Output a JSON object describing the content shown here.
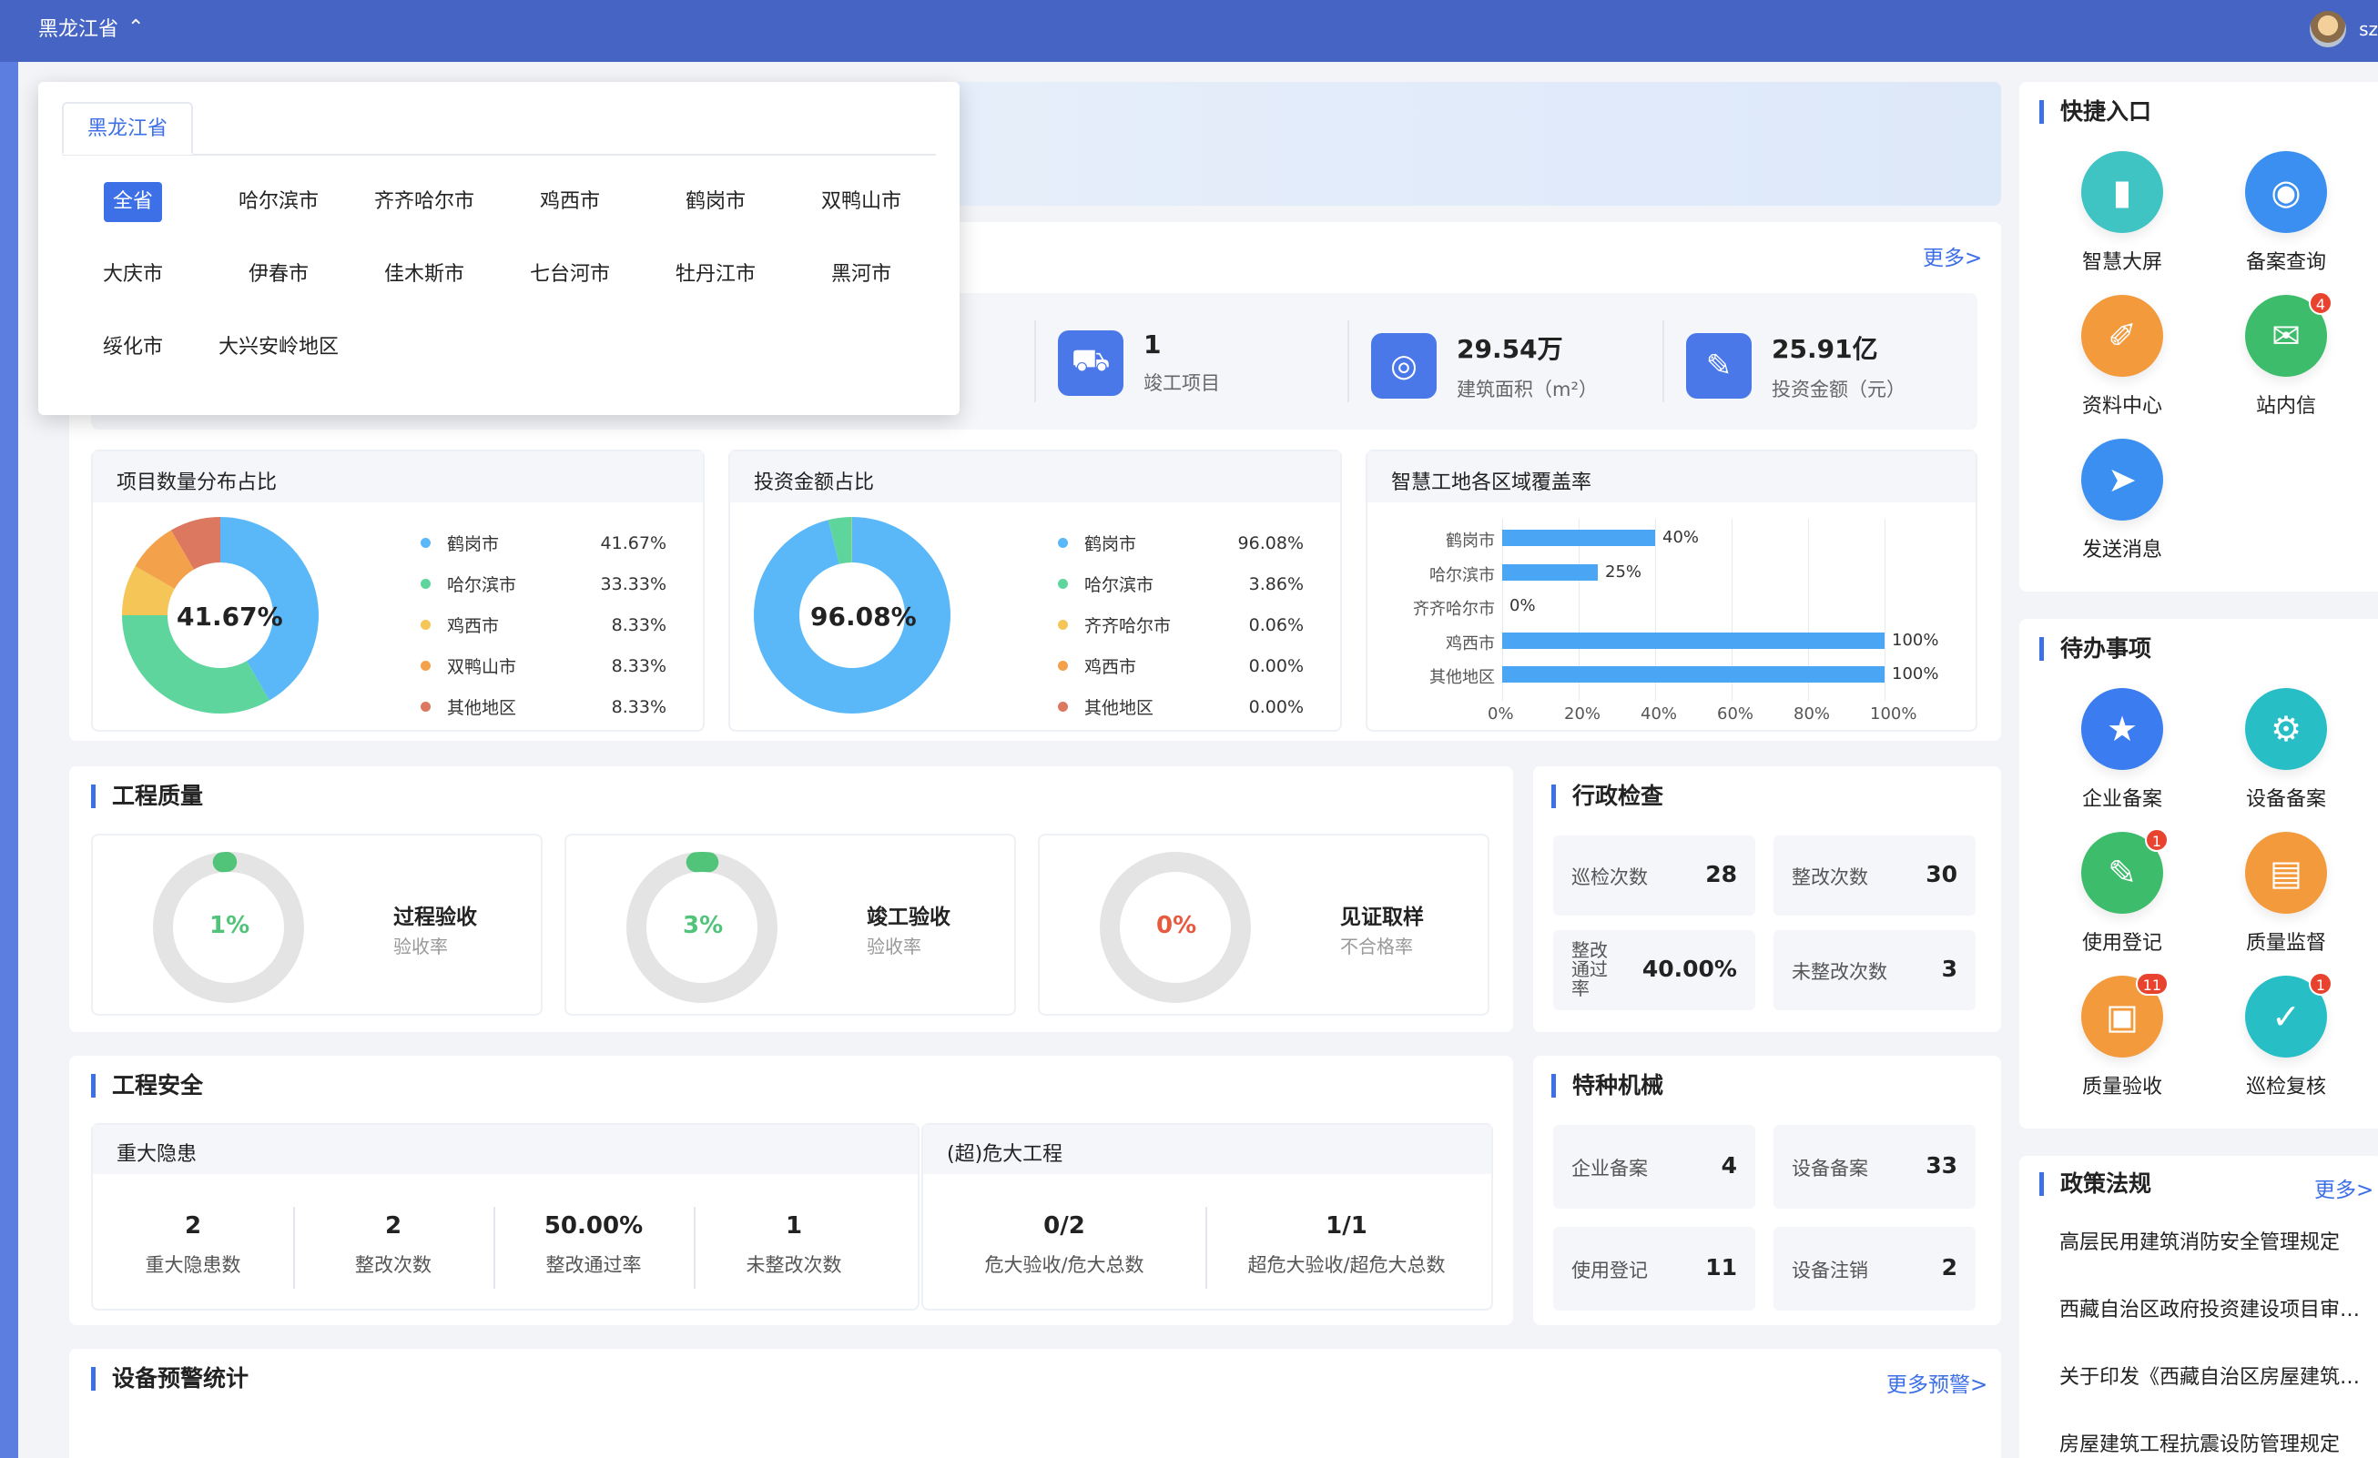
{
  "topbar": {
    "province": "黑龙江省",
    "username": "sz"
  },
  "overview": {
    "more": "更多>",
    "stats": [
      {
        "value": "1",
        "label": "竣工项目"
      },
      {
        "value": "29.54万",
        "label": "建筑面积（m²）"
      },
      {
        "value": "25.91亿",
        "label": "投资金额（元）"
      }
    ]
  },
  "panels": {
    "project_title": "项目数量分布占比",
    "invest_title": "投资金额占比",
    "coverage_title": "智慧工地各区域覆盖率"
  },
  "chart_data": [
    {
      "type": "pie",
      "title": "项目数量分布占比",
      "center_label": "41.67%",
      "categories": [
        "鹤岗市",
        "哈尔滨市",
        "鸡西市",
        "双鸭山市",
        "其他地区"
      ],
      "values": [
        41.67,
        33.33,
        8.33,
        8.33,
        8.33
      ],
      "labels": [
        "41.67%",
        "33.33%",
        "8.33%",
        "8.33%",
        "8.33%"
      ],
      "colors": [
        "#5ab8f8",
        "#5fd59e",
        "#f5c557",
        "#f3a24b",
        "#dc7760"
      ]
    },
    {
      "type": "pie",
      "title": "投资金额占比",
      "center_label": "96.08%",
      "categories": [
        "鹤岗市",
        "哈尔滨市",
        "齐齐哈尔市",
        "鸡西市",
        "其他地区"
      ],
      "values": [
        96.08,
        3.86,
        0.06,
        0.0,
        0.0
      ],
      "labels": [
        "96.08%",
        "3.86%",
        "0.06%",
        "0.00%",
        "0.00%"
      ],
      "colors": [
        "#5ab8f8",
        "#5fd59e",
        "#f5c557",
        "#f3a24b",
        "#dc7760"
      ]
    },
    {
      "type": "bar",
      "orientation": "horizontal",
      "title": "智慧工地各区域覆盖率",
      "categories": [
        "鹤岗市",
        "哈尔滨市",
        "齐齐哈尔市",
        "鸡西市",
        "其他地区"
      ],
      "values": [
        40,
        25,
        0,
        100,
        100
      ],
      "labels": [
        "40%",
        "25%",
        "0%",
        "100%",
        "100%"
      ],
      "xlim": [
        0,
        100
      ],
      "xticks": [
        "0%",
        "20%",
        "40%",
        "60%",
        "80%",
        "100%"
      ],
      "color": "#4aa6f5"
    }
  ],
  "quality": {
    "title": "工程质量",
    "items": [
      {
        "value": "1%",
        "percent": 1,
        "title": "过程验收",
        "sub": "验收率",
        "color": "#52c47a"
      },
      {
        "value": "3%",
        "percent": 3,
        "title": "竣工验收",
        "sub": "验收率",
        "color": "#52c47a"
      },
      {
        "value": "0%",
        "percent": 0,
        "title": "见证取样",
        "sub": "不合格率",
        "color": "#e85a3f"
      }
    ]
  },
  "inspection": {
    "title": "行政检查",
    "items": [
      {
        "label": "巡检次数",
        "value": "28"
      },
      {
        "label": "整改次数",
        "value": "30"
      },
      {
        "label": "整改通过率",
        "value": "40.00%"
      },
      {
        "label": "未整改次数",
        "value": "3"
      }
    ]
  },
  "safety": {
    "title": "工程安全",
    "hazard_title": "重大隐患",
    "hazard": [
      {
        "value": "2",
        "label": "重大隐患数"
      },
      {
        "value": "2",
        "label": "整改次数"
      },
      {
        "value": "50.00%",
        "label": "整改通过率"
      },
      {
        "value": "1",
        "label": "未整改次数"
      }
    ],
    "danger_title": "(超)危大工程",
    "danger": [
      {
        "value": "0/2",
        "label": "危大验收/危大总数"
      },
      {
        "value": "1/1",
        "label": "超危大验收/超危大总数"
      }
    ]
  },
  "machinery": {
    "title": "特种机械",
    "items": [
      {
        "label": "企业备案",
        "value": "4"
      },
      {
        "label": "设备备案",
        "value": "33"
      },
      {
        "label": "使用登记",
        "value": "11"
      },
      {
        "label": "设备注销",
        "value": "2"
      }
    ]
  },
  "warning": {
    "title": "设备预警统计",
    "more": "更多预警>"
  },
  "quick": {
    "title": "快捷入口",
    "items": [
      {
        "label": "智慧大屏",
        "icon": "dashboard-icon",
        "color": "#3fc3c3"
      },
      {
        "label": "备案查询",
        "icon": "search-record-icon",
        "color": "#3b8ff0"
      },
      {
        "label": "资料中心",
        "icon": "paperclip-icon",
        "color": "#f39a3d"
      },
      {
        "label": "站内信",
        "icon": "mail-icon",
        "color": "#3dbd6b",
        "badge": "4"
      },
      {
        "label": "发送消息",
        "icon": "send-icon",
        "color": "#3b8ff0"
      }
    ]
  },
  "todo": {
    "title": "待办事项",
    "items": [
      {
        "label": "企业备案",
        "icon": "shield-icon",
        "color": "#3b7cf0"
      },
      {
        "label": "设备备案",
        "icon": "gear-icon",
        "color": "#27bfc5"
      },
      {
        "label": "使用登记",
        "icon": "edit-icon",
        "color": "#3dbd6b",
        "badge": "1"
      },
      {
        "label": "质量监督",
        "icon": "folder-icon",
        "color": "#f39a3d"
      },
      {
        "label": "质量验收",
        "icon": "stamp-icon",
        "color": "#f39a3d",
        "badge": "11"
      },
      {
        "label": "巡检复核",
        "icon": "clipboard-icon",
        "color": "#27bfc5",
        "badge": "1"
      }
    ]
  },
  "policy": {
    "title": "政策法规",
    "more": "更多>",
    "items": [
      "高层民用建筑消防安全管理规定",
      "西藏自治区政府投资建设项目审…",
      "关于印发《西藏自治区房屋建筑…",
      "房屋建筑工程抗震设防管理规定"
    ]
  },
  "dropdown": {
    "tab": "黑龙江省",
    "cities": [
      "全省",
      "哈尔滨市",
      "齐齐哈尔市",
      "鸡西市",
      "鹤岗市",
      "双鸭山市",
      "大庆市",
      "伊春市",
      "佳木斯市",
      "七台河市",
      "牡丹江市",
      "黑河市",
      "绥化市",
      "大兴安岭地区"
    ]
  }
}
